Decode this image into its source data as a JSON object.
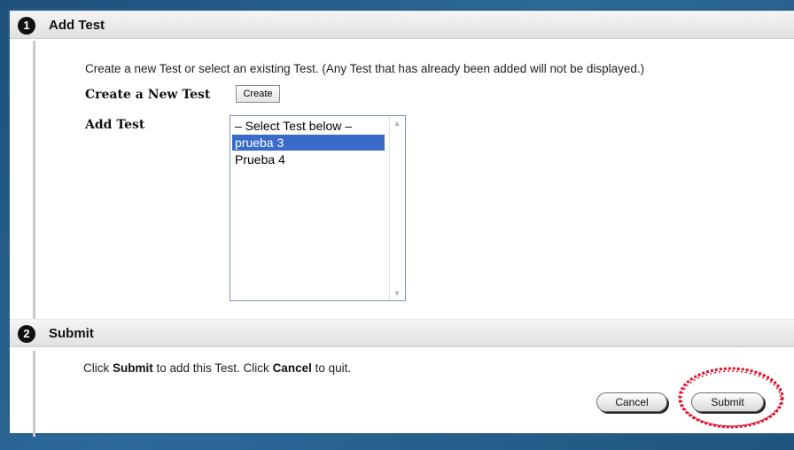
{
  "section1": {
    "number": "1",
    "title": "Add Test",
    "instructions": "Create a new Test or select an existing Test. (Any Test that has already been added will not be displayed.)",
    "create_label": "Create a New Test",
    "create_button": "Create",
    "add_label": "Add Test",
    "list": {
      "options": [
        "– Select Test below –",
        "prueba 3",
        "Prueba 4"
      ],
      "selected": "prueba 3"
    }
  },
  "section2": {
    "number": "2",
    "title": "Submit",
    "text_prefix": "Click ",
    "text_submit": "Submit",
    "text_middle": " to add this Test. Click ",
    "text_cancel": "Cancel",
    "text_suffix": " to quit.",
    "cancel_button": "Cancel",
    "submit_button": "Submit"
  },
  "colors": {
    "selection": "#3a6bc9",
    "annotation": "#e0102a"
  }
}
